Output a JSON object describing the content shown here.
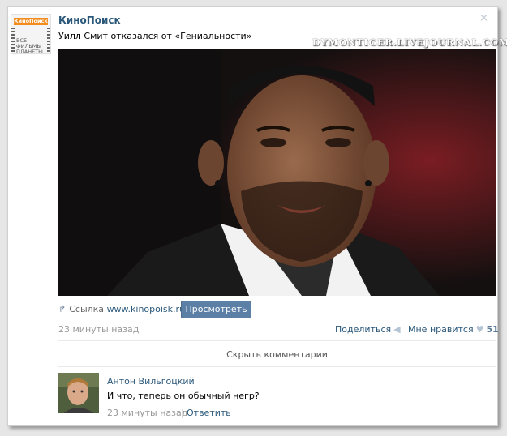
{
  "post": {
    "group_name": "КиноПоиск",
    "group_logo_text": "КиноПоиск",
    "group_slogan": "ВСЕ ФИЛЬМЫ ПЛАНЕТЫ",
    "text": "Уилл Смит отказался от «Гениальности»",
    "watermark": "DYMONTIGER.LIVEJOURNAL.COM",
    "link_label": "Ссылка",
    "link_url": "www.kinopoisk.ru",
    "view_button": "Просмотреть",
    "time": "23 минуты назад",
    "share_label": "Поделиться",
    "like_label": "Мне нравится",
    "like_count": "51",
    "hide_comments": "Скрыть комментарии",
    "close_icon": "×"
  },
  "comment": {
    "author": "Антон Вильгоцкий",
    "text": "И что, теперь он обычный негр?",
    "time": "23 минуты назад",
    "divider": "|",
    "reply": "Ответить"
  },
  "colors": {
    "link": "#2b587a",
    "button": "#5c7fa6",
    "meta": "#999999"
  }
}
